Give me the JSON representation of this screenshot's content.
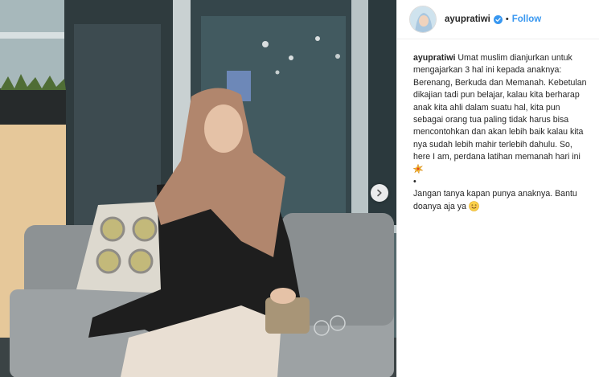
{
  "post": {
    "author": {
      "username": "ayupratiwi",
      "verified": true,
      "follow_label": "Follow",
      "separator": "•"
    },
    "caption": {
      "username": "ayupratiwi",
      "paragraph1": "Umat muslim dianjurkan untuk mengajarkan 3 hal ini kepada anaknya: Berenang, Berkuda dan Memanah. Kebetulan dikajian tadi pun belajar, kalau kita berharap anak kita ahli dalam suatu hal, kita pun sebagai orang tua paling tidak harus bisa mencontohkan dan akan lebih baik kalau kita nya sudah lebih mahir terlebih dahulu. So, here I am, perdana latihan memanah hari ini",
      "bullet": "•",
      "paragraph2": "Jangan tanya kapan punya anaknya. Bantu doanya aja ya"
    },
    "icons": {
      "verified": "verified-badge-icon",
      "next": "chevron-right-icon",
      "sparkle": "collision-emoji-icon",
      "smile": "smiling-face-emoji-icon"
    },
    "colors": {
      "accent": "#3897f0",
      "text": "#262626",
      "border": "#efefef"
    }
  }
}
